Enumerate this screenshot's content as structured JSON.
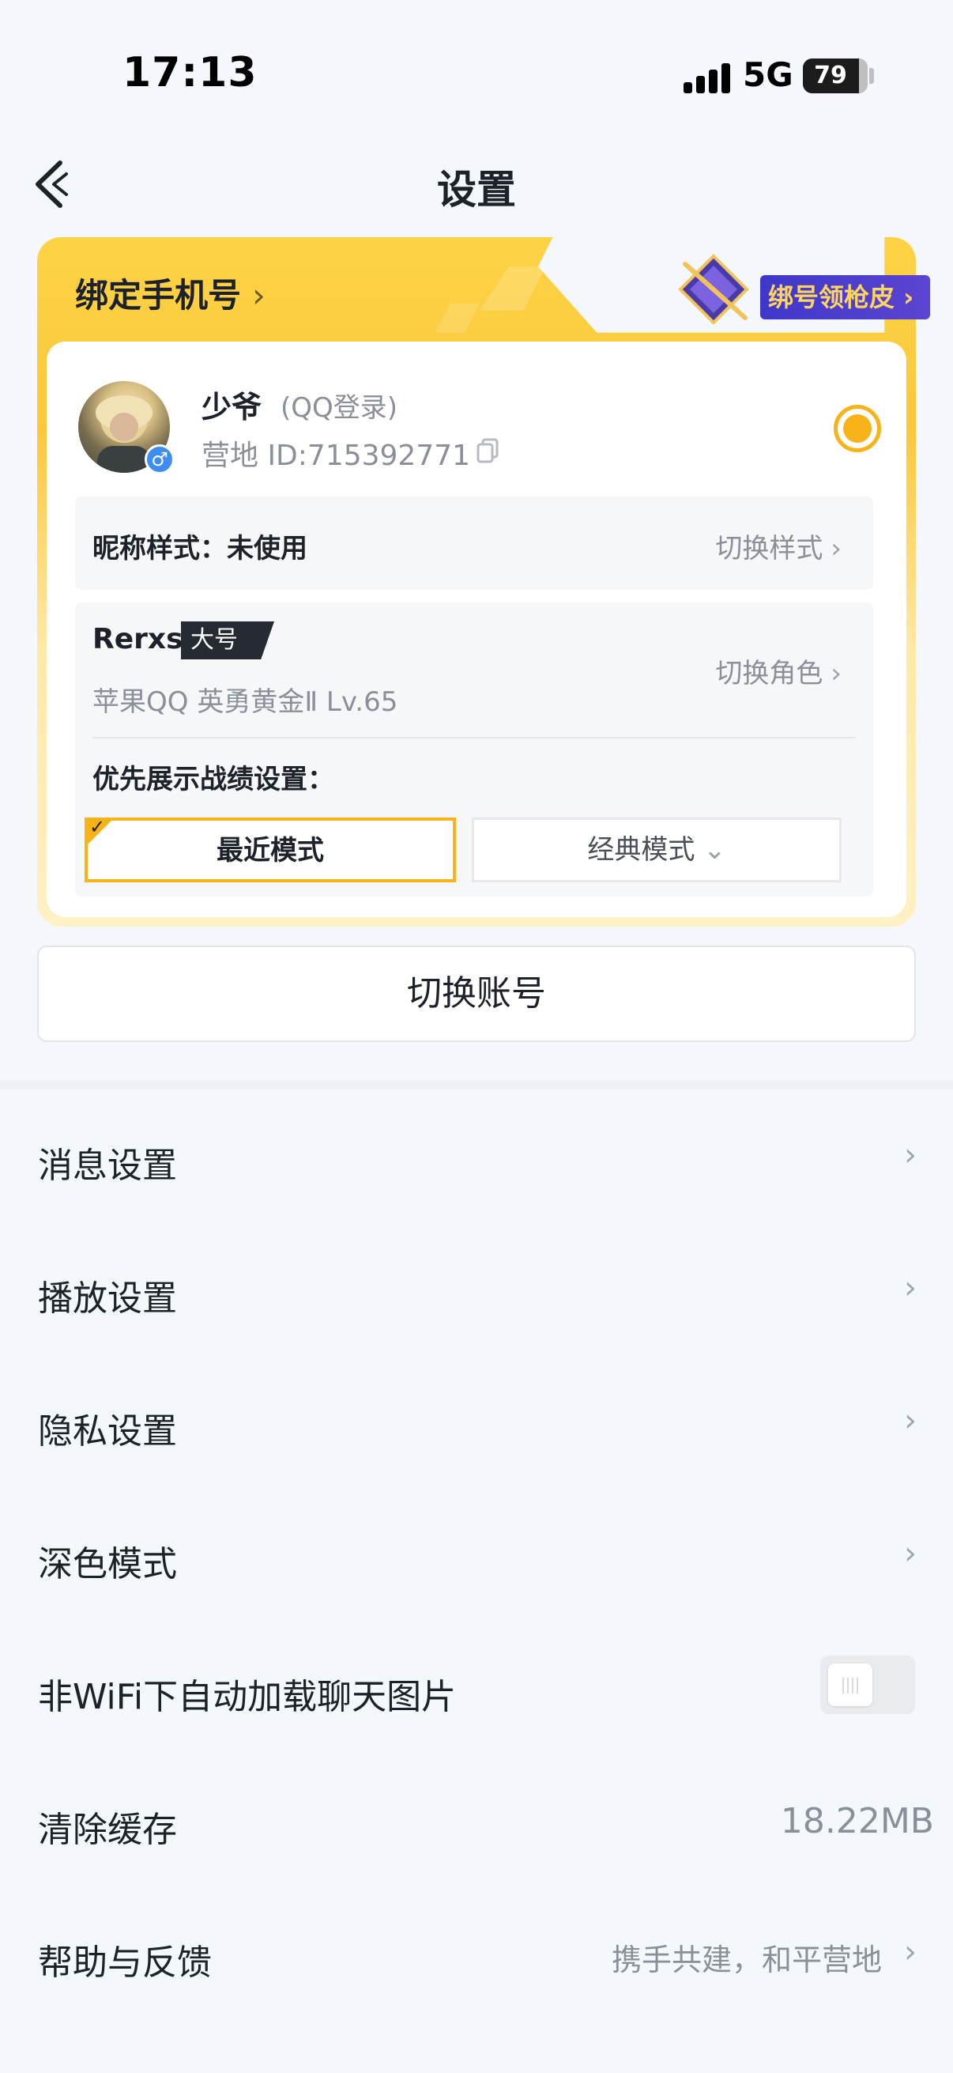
{
  "status_bar": {
    "time": "17:13",
    "network": "5G",
    "battery": "79"
  },
  "header": {
    "title": "设置"
  },
  "account_card": {
    "bind_phone": "绑定手机号",
    "promo": "绑号领枪皮",
    "nickname": "少爷",
    "login_type": "(QQ登录)",
    "camp_id": "营地 ID:715392771",
    "gender": "♂",
    "nick_style_label": "昵称样式：未使用",
    "nick_style_action": "切换样式",
    "role_name": "Rerxs",
    "role_tag": "大号",
    "role_info": "苹果QQ  英勇黄金Ⅱ  Lv.65",
    "switch_role": "切换角色",
    "record_title": "优先展示战绩设置：",
    "mode_recent": "最近模式",
    "mode_classic": "经典模式",
    "accent_color": "#f7b318"
  },
  "switch_account": "切换账号",
  "menu": {
    "message": "消息设置",
    "playback": "播放设置",
    "privacy": "隐私设置",
    "dark_mode": "深色模式",
    "wifi_images": "非WiFi下自动加载聊天图片",
    "clear_cache": "清除缓存",
    "cache_size": "18.22MB",
    "help": "帮助与反馈",
    "help_sub": "携手共建，和平营地"
  },
  "toggle_wifi_images": false
}
